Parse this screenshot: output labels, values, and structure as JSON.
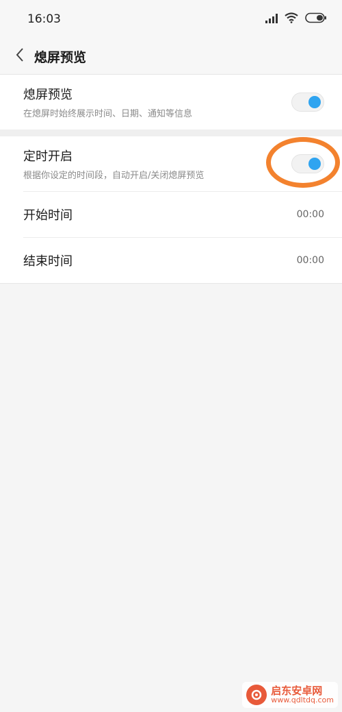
{
  "status_bar": {
    "time": "16:03"
  },
  "header": {
    "title": "熄屏预览"
  },
  "settings": {
    "aod_title": "熄屏预览",
    "aod_subtitle": "在熄屏时始终展示时间、日期、通知等信息",
    "aod_enabled": true,
    "schedule_title": "定时开启",
    "schedule_subtitle": "根据你设定的时间段，自动开启/关闭熄屏预览",
    "schedule_enabled": true,
    "start_label": "开始时间",
    "start_value": "00:00",
    "end_label": "结束时间",
    "end_value": "00:00"
  },
  "watermark": {
    "title": "启东安卓网",
    "url": "www.qdltdq.com"
  },
  "colors": {
    "accent": "#2fa4f0",
    "annotation": "#f3822e"
  }
}
